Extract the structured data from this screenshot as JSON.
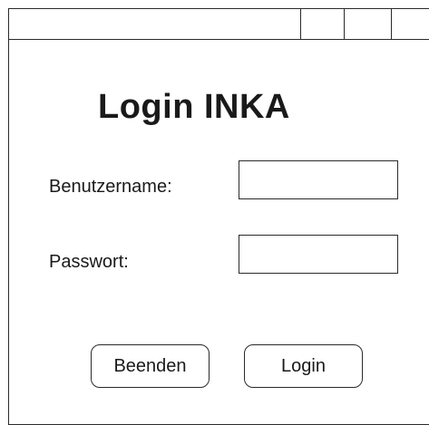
{
  "app": {
    "title": "Login INKA"
  },
  "form": {
    "username_label": "Benutzername:",
    "username_value": "",
    "password_label": "Passwort:",
    "password_value": ""
  },
  "buttons": {
    "quit_label": "Beenden",
    "login_label": "Login"
  }
}
